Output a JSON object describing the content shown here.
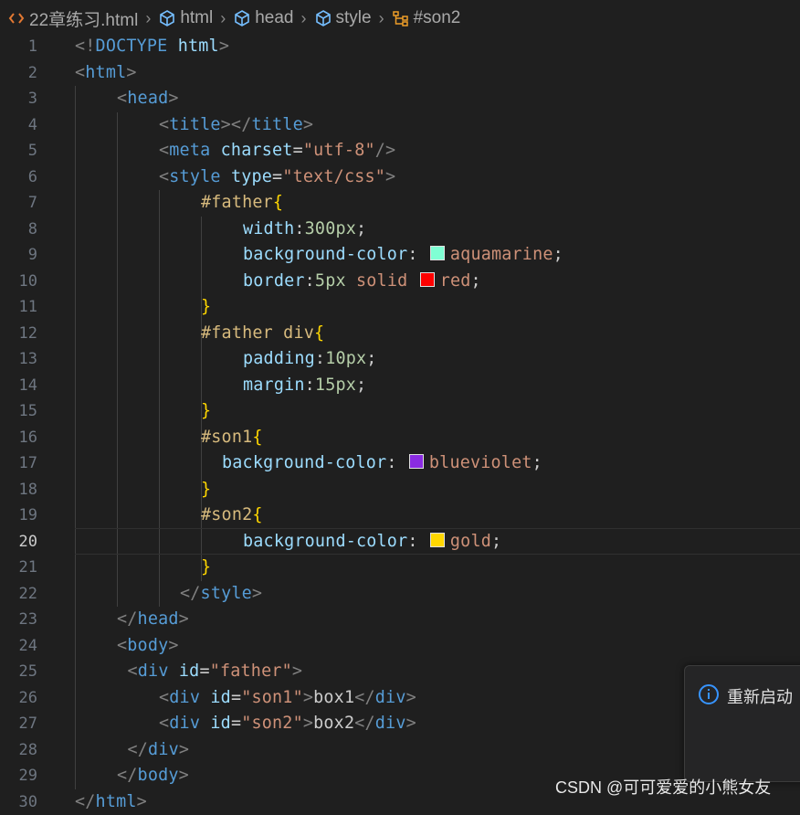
{
  "breadcrumb": {
    "file": "22章练习.html",
    "items": [
      "html",
      "head",
      "style",
      "#son2"
    ]
  },
  "editor": {
    "current_line": 20,
    "lines": [
      {
        "n": "1",
        "indent": 0,
        "tokens": [
          [
            "punct",
            "<!"
          ],
          [
            "tag",
            "DOCTYPE"
          ],
          [
            "plain",
            " "
          ],
          [
            "attr",
            "html"
          ],
          [
            "punct",
            ">"
          ]
        ]
      },
      {
        "n": "2",
        "indent": 0,
        "tokens": [
          [
            "punct",
            "<"
          ],
          [
            "tag",
            "html"
          ],
          [
            "punct",
            ">"
          ]
        ]
      },
      {
        "n": "3",
        "indent": 1,
        "tokens": [
          [
            "punct",
            "<"
          ],
          [
            "tag",
            "head"
          ],
          [
            "punct",
            ">"
          ]
        ]
      },
      {
        "n": "4",
        "indent": 2,
        "tokens": [
          [
            "punct",
            "<"
          ],
          [
            "tag",
            "title"
          ],
          [
            "punct",
            "></"
          ],
          [
            "tag",
            "title"
          ],
          [
            "punct",
            ">"
          ]
        ]
      },
      {
        "n": "5",
        "indent": 2,
        "tokens": [
          [
            "punct",
            "<"
          ],
          [
            "tag",
            "meta"
          ],
          [
            "plain",
            " "
          ],
          [
            "attr",
            "charset"
          ],
          [
            "plain",
            "="
          ],
          [
            "str",
            "\"utf-8\""
          ],
          [
            "punct",
            "/>"
          ]
        ]
      },
      {
        "n": "6",
        "indent": 2,
        "tokens": [
          [
            "punct",
            "<"
          ],
          [
            "tag",
            "style"
          ],
          [
            "plain",
            " "
          ],
          [
            "attr",
            "type"
          ],
          [
            "plain",
            "="
          ],
          [
            "str",
            "\"text/css\""
          ],
          [
            "punct",
            ">"
          ]
        ]
      },
      {
        "n": "7",
        "indent": 3,
        "tokens": [
          [
            "sel",
            "#father"
          ],
          [
            "brace",
            "{"
          ]
        ]
      },
      {
        "n": "8",
        "indent": 4,
        "tokens": [
          [
            "prop",
            "width"
          ],
          [
            "plain",
            ":"
          ],
          [
            "num",
            "300px"
          ],
          [
            "plain",
            ";"
          ]
        ]
      },
      {
        "n": "9",
        "indent": 4,
        "tokens": [
          [
            "prop",
            "background-color"
          ],
          [
            "plain",
            ": "
          ],
          [
            "swatch",
            "#7fffd4"
          ],
          [
            "val",
            "aquamarine"
          ],
          [
            "plain",
            ";"
          ]
        ]
      },
      {
        "n": "10",
        "indent": 4,
        "tokens": [
          [
            "prop",
            "border"
          ],
          [
            "plain",
            ":"
          ],
          [
            "num",
            "5px"
          ],
          [
            "plain",
            " "
          ],
          [
            "val",
            "solid"
          ],
          [
            "plain",
            " "
          ],
          [
            "swatch",
            "#ff0000"
          ],
          [
            "val",
            "red"
          ],
          [
            "plain",
            ";"
          ]
        ]
      },
      {
        "n": "11",
        "indent": 3,
        "tokens": [
          [
            "brace",
            "}"
          ]
        ]
      },
      {
        "n": "12",
        "indent": 3,
        "tokens": [
          [
            "sel",
            "#father div"
          ],
          [
            "brace",
            "{"
          ]
        ]
      },
      {
        "n": "13",
        "indent": 4,
        "tokens": [
          [
            "prop",
            "padding"
          ],
          [
            "plain",
            ":"
          ],
          [
            "num",
            "10px"
          ],
          [
            "plain",
            ";"
          ]
        ]
      },
      {
        "n": "14",
        "indent": 4,
        "tokens": [
          [
            "prop",
            "margin"
          ],
          [
            "plain",
            ":"
          ],
          [
            "num",
            "15px"
          ],
          [
            "plain",
            ";"
          ]
        ]
      },
      {
        "n": "15",
        "indent": 3,
        "tokens": [
          [
            "brace",
            "}"
          ]
        ]
      },
      {
        "n": "16",
        "indent": 3,
        "tokens": [
          [
            "sel",
            "#son1"
          ],
          [
            "brace",
            "{"
          ]
        ]
      },
      {
        "n": "17",
        "indent": 3.5,
        "tokens": [
          [
            "prop",
            "background-color"
          ],
          [
            "plain",
            ": "
          ],
          [
            "swatch",
            "#8a2be2"
          ],
          [
            "val",
            "blueviolet"
          ],
          [
            "plain",
            ";"
          ]
        ]
      },
      {
        "n": "18",
        "indent": 3,
        "tokens": [
          [
            "brace",
            "}"
          ]
        ]
      },
      {
        "n": "19",
        "indent": 3,
        "tokens": [
          [
            "sel",
            "#son2"
          ],
          [
            "brace",
            "{"
          ]
        ]
      },
      {
        "n": "20",
        "indent": 4,
        "tokens": [
          [
            "prop",
            "background-color"
          ],
          [
            "plain",
            ": "
          ],
          [
            "swatch",
            "#ffd700"
          ],
          [
            "val",
            "gold"
          ],
          [
            "plain",
            ";"
          ]
        ]
      },
      {
        "n": "21",
        "indent": 3,
        "tokens": [
          [
            "brace",
            "}"
          ]
        ]
      },
      {
        "n": "22",
        "indent": 2.5,
        "tokens": [
          [
            "punct",
            "</"
          ],
          [
            "tag",
            "style"
          ],
          [
            "punct",
            ">"
          ]
        ]
      },
      {
        "n": "23",
        "indent": 1,
        "tokens": [
          [
            "punct",
            "</"
          ],
          [
            "tag",
            "head"
          ],
          [
            "punct",
            ">"
          ]
        ]
      },
      {
        "n": "24",
        "indent": 1,
        "tokens": [
          [
            "punct",
            "<"
          ],
          [
            "tag",
            "body"
          ],
          [
            "punct",
            ">"
          ]
        ]
      },
      {
        "n": "25",
        "indent": 1.25,
        "tokens": [
          [
            "punct",
            "<"
          ],
          [
            "tag",
            "div"
          ],
          [
            "plain",
            " "
          ],
          [
            "attr",
            "id"
          ],
          [
            "plain",
            "="
          ],
          [
            "str",
            "\"father\""
          ],
          [
            "punct",
            ">"
          ]
        ]
      },
      {
        "n": "26",
        "indent": 2,
        "tokens": [
          [
            "punct",
            "<"
          ],
          [
            "tag",
            "div"
          ],
          [
            "plain",
            " "
          ],
          [
            "attr",
            "id"
          ],
          [
            "plain",
            "="
          ],
          [
            "str",
            "\"son1\""
          ],
          [
            "punct",
            ">"
          ],
          [
            "plain",
            "box1"
          ],
          [
            "punct",
            "</"
          ],
          [
            "tag",
            "div"
          ],
          [
            "punct",
            ">"
          ]
        ]
      },
      {
        "n": "27",
        "indent": 2,
        "tokens": [
          [
            "punct",
            "<"
          ],
          [
            "tag",
            "div"
          ],
          [
            "plain",
            " "
          ],
          [
            "attr",
            "id"
          ],
          [
            "plain",
            "="
          ],
          [
            "str",
            "\"son2\""
          ],
          [
            "punct",
            ">"
          ],
          [
            "plain",
            "box2"
          ],
          [
            "punct",
            "</"
          ],
          [
            "tag",
            "div"
          ],
          [
            "punct",
            ">"
          ]
        ]
      },
      {
        "n": "28",
        "indent": 1.25,
        "tokens": [
          [
            "punct",
            "</"
          ],
          [
            "tag",
            "div"
          ],
          [
            "punct",
            ">"
          ]
        ]
      },
      {
        "n": "29",
        "indent": 1,
        "tokens": [
          [
            "punct",
            "</"
          ],
          [
            "tag",
            "body"
          ],
          [
            "punct",
            ">"
          ]
        ]
      },
      {
        "n": "30",
        "indent": 0,
        "tokens": [
          [
            "punct",
            "</"
          ],
          [
            "tag",
            "html"
          ],
          [
            "punct",
            ">"
          ]
        ]
      }
    ]
  },
  "notification": {
    "text": "重新启动"
  },
  "watermark": "CSDN @可可爱爱的小熊女友",
  "colors": {
    "background": "#1f1f1f",
    "tag": "#569cd6",
    "attribute": "#9cdcfe",
    "string": "#ce9178",
    "number": "#b5cea8",
    "selector": "#d7ba7d",
    "brace": "#ffd700"
  }
}
